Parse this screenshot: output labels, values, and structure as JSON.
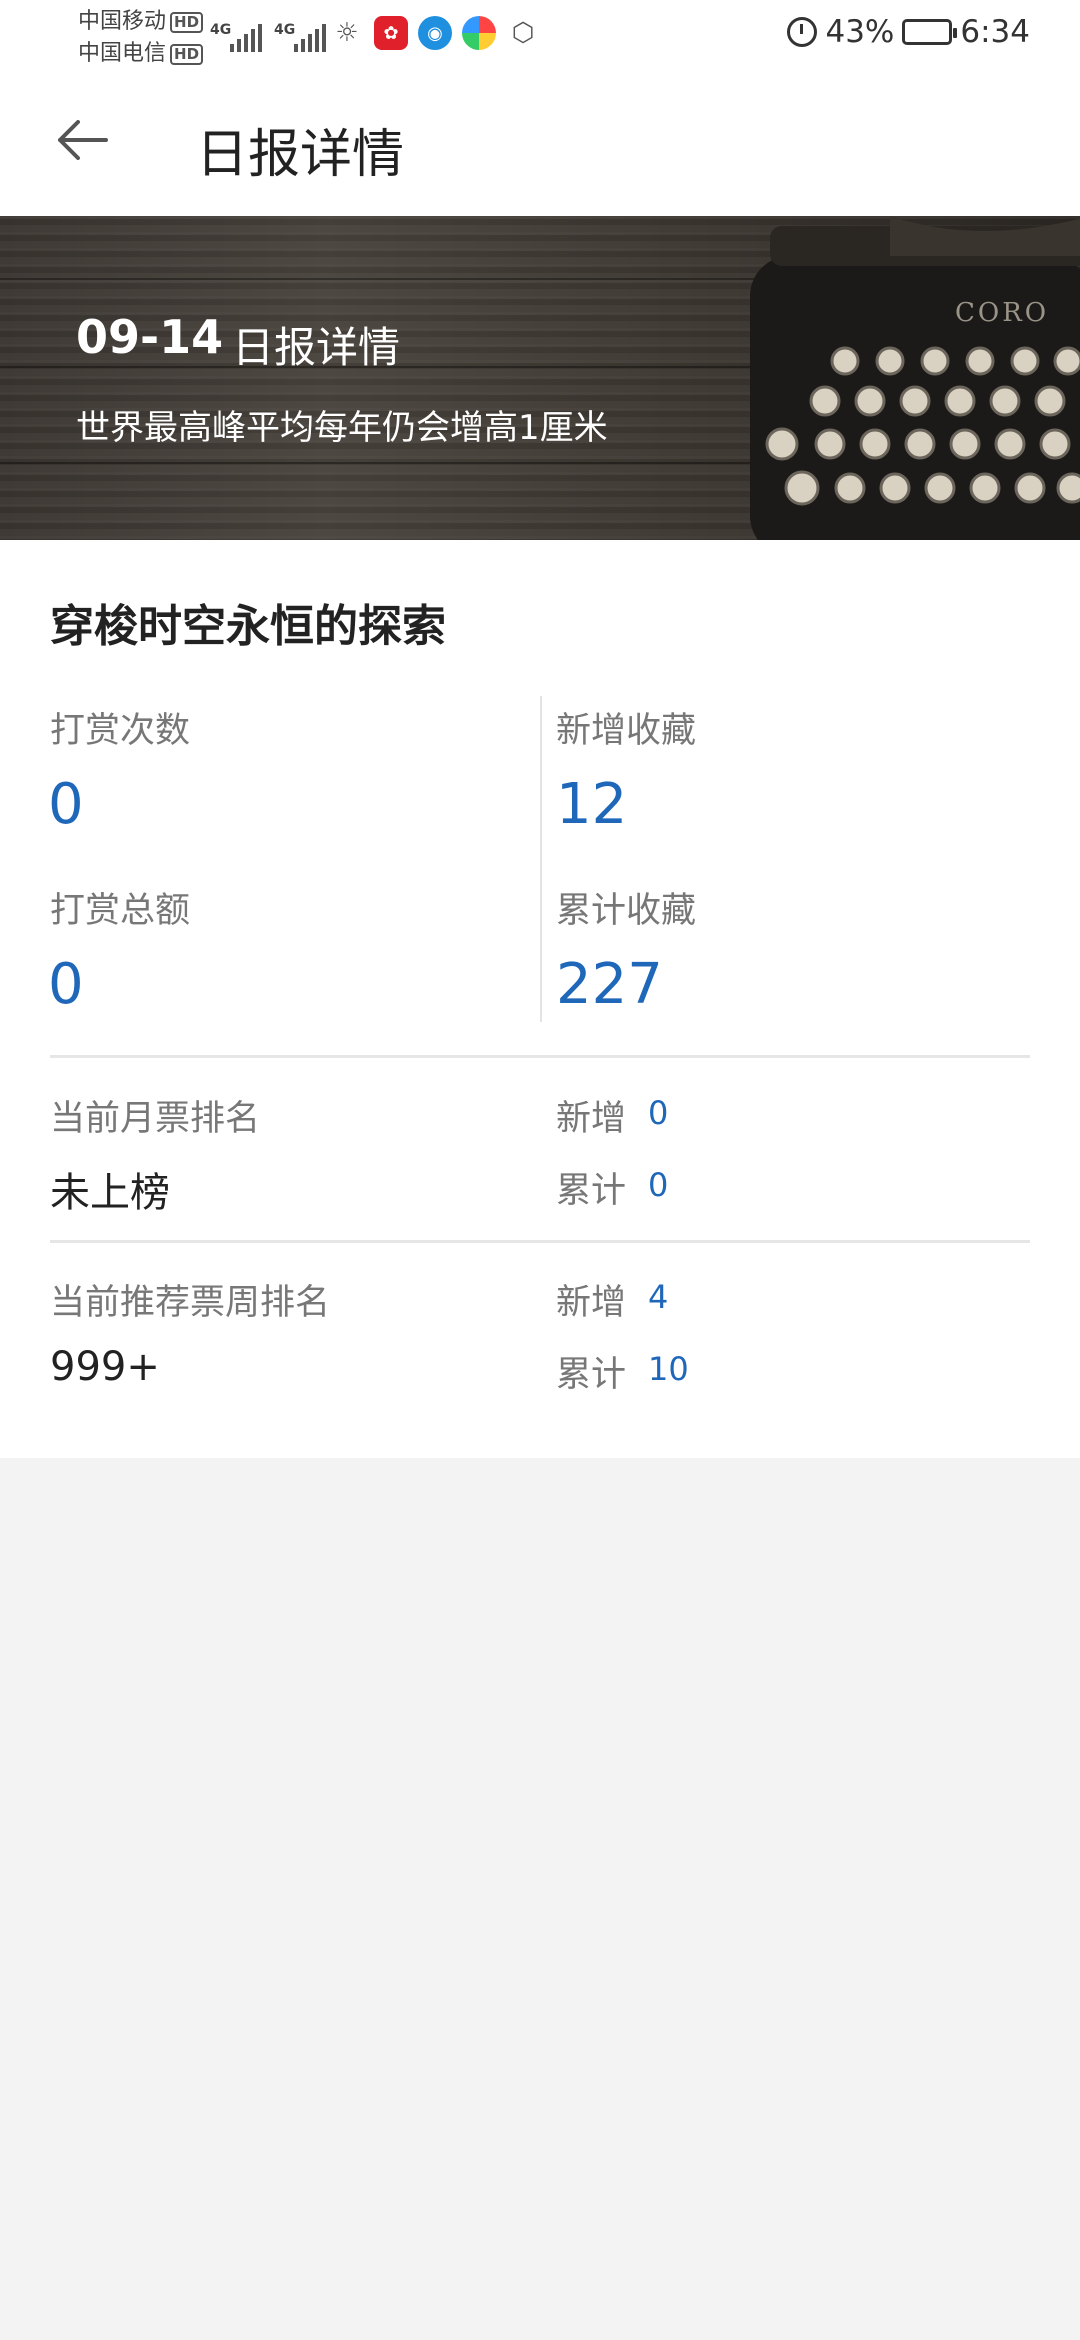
{
  "status_bar": {
    "carrier1": "中国移动",
    "carrier2": "中国电信",
    "hd": "HD",
    "net1": "4G",
    "net2": "4G",
    "battery": "43%",
    "time": "6:34"
  },
  "header": {
    "title": "日报详情"
  },
  "banner": {
    "date": "09-14",
    "title": "日报详情",
    "subtitle": "世界最高峰平均每年仍会增高1厘米"
  },
  "book": {
    "title": "穿梭时空永恒的探索"
  },
  "stats": {
    "tip_count_label": "打赏次数",
    "tip_count_value": "0",
    "new_fav_label": "新增收藏",
    "new_fav_value": "12",
    "tip_total_label": "打赏总额",
    "tip_total_value": "0",
    "total_fav_label": "累计收藏",
    "total_fav_value": "227"
  },
  "monthly_ticket": {
    "label": "当前月票排名",
    "value": "未上榜",
    "new_label": "新增",
    "new_value": "0",
    "total_label": "累计",
    "total_value": "0"
  },
  "recommend_ticket": {
    "label": "当前推荐票周排名",
    "value": "999+",
    "new_label": "新增",
    "new_value": "4",
    "total_label": "累计",
    "total_value": "10"
  },
  "colors": {
    "accent_blue": "#1f67b9",
    "label_gray": "#777777"
  }
}
